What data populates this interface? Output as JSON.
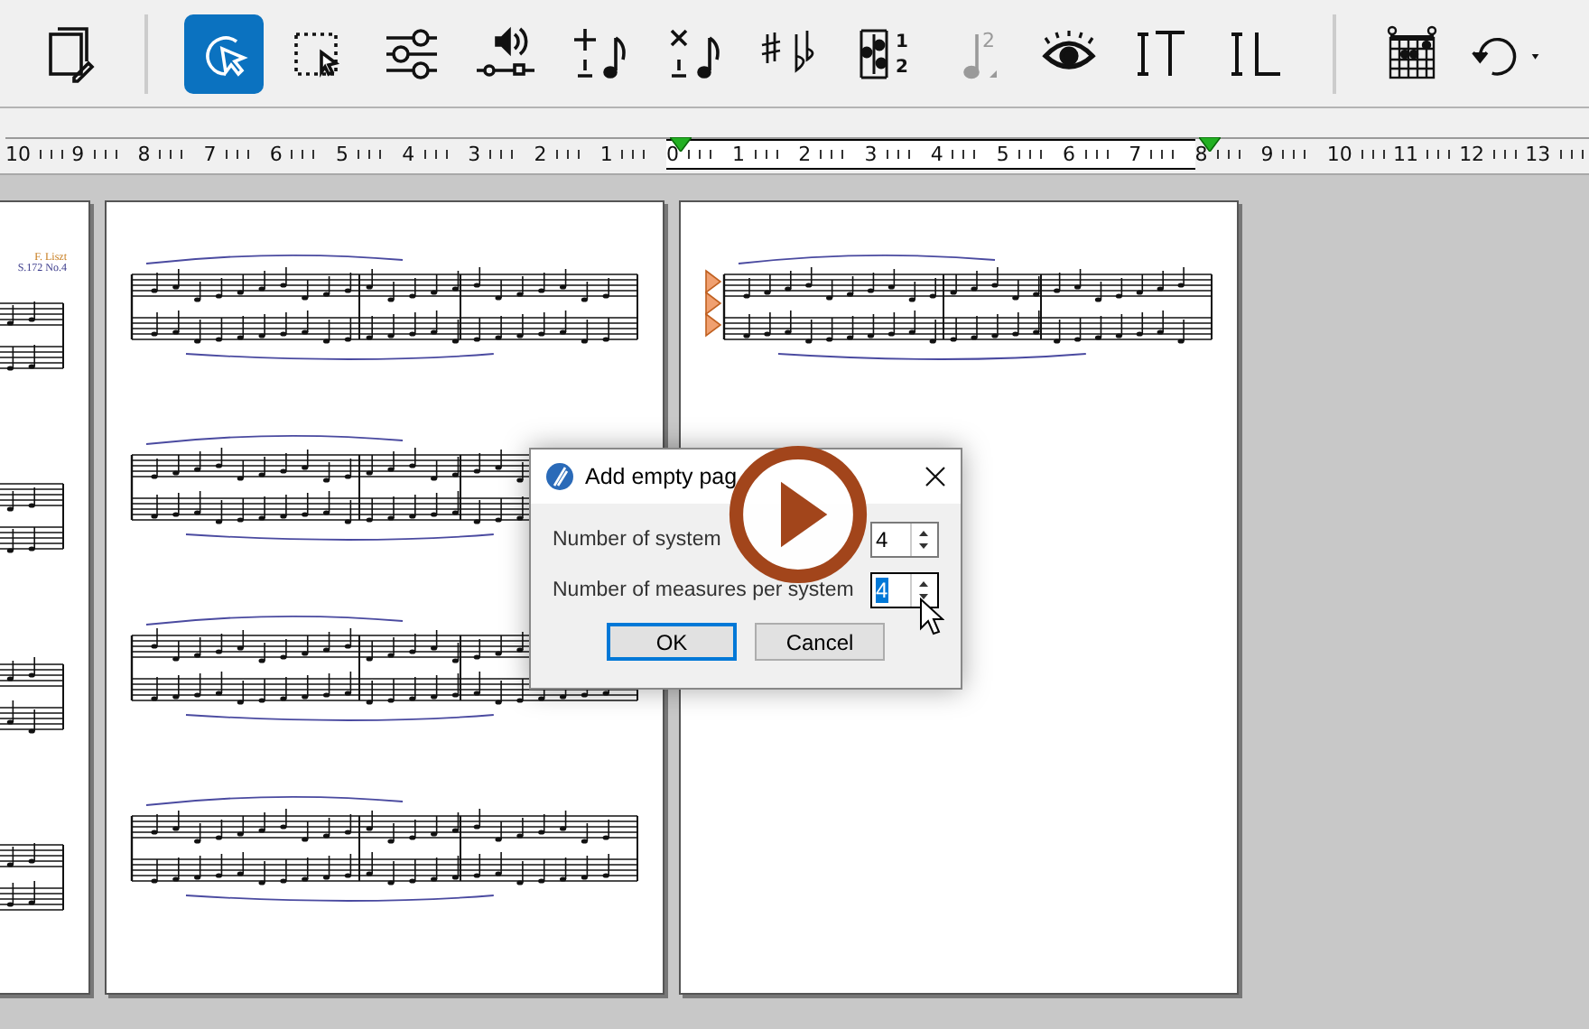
{
  "toolbar": {
    "groups": [
      [
        {
          "kind": "page-setup",
          "selected": false,
          "disabled": false
        }
      ],
      [
        {
          "kind": "select",
          "selected": true,
          "disabled": false
        },
        {
          "kind": "marquee",
          "selected": false,
          "disabled": false
        },
        {
          "kind": "mixer",
          "selected": false,
          "disabled": false
        },
        {
          "kind": "volume",
          "selected": false,
          "disabled": false
        },
        {
          "kind": "add-note",
          "selected": false,
          "disabled": false
        },
        {
          "kind": "delete-note",
          "selected": false,
          "disabled": false
        },
        {
          "kind": "accidentals",
          "selected": false,
          "disabled": false
        },
        {
          "kind": "voices",
          "selected": false,
          "disabled": false,
          "digits": [
            "1",
            "2"
          ]
        },
        {
          "kind": "note-voice",
          "selected": false,
          "disabled": true,
          "digits": [
            "2"
          ]
        },
        {
          "kind": "view",
          "selected": false,
          "disabled": false
        },
        {
          "kind": "text",
          "selected": false,
          "disabled": false
        },
        {
          "kind": "lyrics",
          "selected": false,
          "disabled": false
        }
      ],
      [
        {
          "kind": "chord",
          "selected": false,
          "disabled": false
        },
        {
          "kind": "undo",
          "selected": false,
          "disabled": false
        }
      ]
    ]
  },
  "ruler": {
    "labels": [
      {
        "text": "10",
        "in_range": false,
        "marker": false
      },
      {
        "text": "9",
        "in_range": false,
        "marker": false
      },
      {
        "text": "8",
        "in_range": false,
        "marker": false
      },
      {
        "text": "7",
        "in_range": false,
        "marker": false
      },
      {
        "text": "6",
        "in_range": false,
        "marker": false
      },
      {
        "text": "5",
        "in_range": false,
        "marker": false
      },
      {
        "text": "4",
        "in_range": false,
        "marker": false
      },
      {
        "text": "3",
        "in_range": false,
        "marker": false
      },
      {
        "text": "2",
        "in_range": false,
        "marker": false
      },
      {
        "text": "1",
        "in_range": false,
        "marker": false
      },
      {
        "text": "0",
        "in_range": true,
        "marker": true
      },
      {
        "text": "1",
        "in_range": true,
        "marker": false
      },
      {
        "text": "2",
        "in_range": true,
        "marker": false
      },
      {
        "text": "3",
        "in_range": true,
        "marker": false
      },
      {
        "text": "4",
        "in_range": true,
        "marker": false
      },
      {
        "text": "5",
        "in_range": true,
        "marker": false
      },
      {
        "text": "6",
        "in_range": true,
        "marker": false
      },
      {
        "text": "7",
        "in_range": true,
        "marker": false
      },
      {
        "text": "8",
        "in_range": false,
        "marker": true
      },
      {
        "text": "9",
        "in_range": false,
        "marker": false
      },
      {
        "text": "10",
        "in_range": false,
        "marker": false
      },
      {
        "text": "11",
        "in_range": false,
        "marker": false
      },
      {
        "text": "12",
        "in_range": false,
        "marker": false
      },
      {
        "text": "13",
        "in_range": false,
        "marker": false
      }
    ]
  },
  "pages": [
    {
      "header": [
        "F. Liszt",
        "S.172 No.4"
      ],
      "systems": [
        {
          "kind": "grand-staff"
        },
        {
          "kind": "grand-staff"
        },
        {
          "kind": "grand-staff"
        },
        {
          "kind": "grand-staff"
        }
      ]
    },
    {
      "systems": [
        {
          "kind": "grand-staff"
        },
        {
          "kind": "grand-staff"
        },
        {
          "kind": "grand-staff"
        },
        {
          "kind": "grand-staff"
        }
      ]
    },
    {
      "systems": [
        {
          "kind": "grand-staff-marked"
        }
      ]
    }
  ],
  "dialog": {
    "title": "Add empty pag",
    "fields": [
      {
        "label": "Number of system",
        "value": "4",
        "focused": false
      },
      {
        "label": "Number of measures per system",
        "value": "4",
        "focused": true
      }
    ],
    "buttons": [
      {
        "label": "OK",
        "default": true
      },
      {
        "label": "Cancel",
        "default": false
      }
    ]
  }
}
